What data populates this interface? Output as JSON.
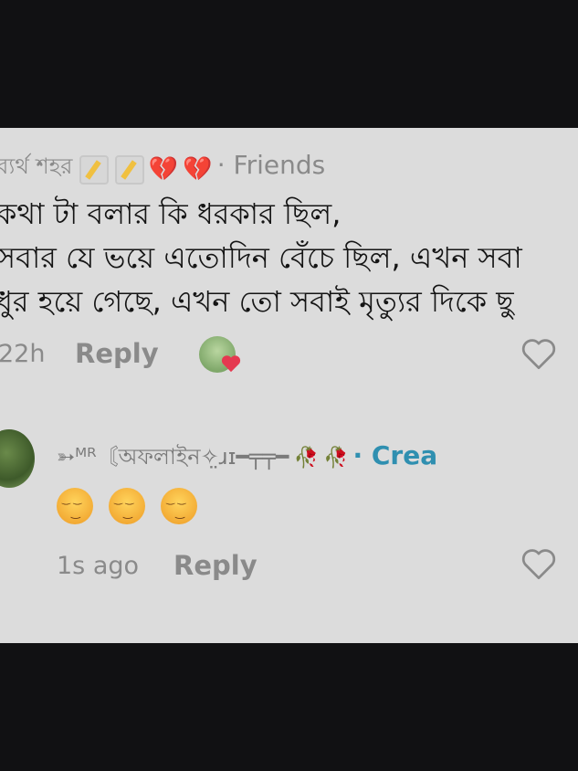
{
  "comment1": {
    "author": "ব্যর্থ শহর",
    "author_badge": "· Friends",
    "lines": [
      "কথা টা বলার কি ধরকার ছিল,",
      "সবার যে ভয়ে এতোদিন বেঁচে ছিল, এখন সবা",
      "ধুর হয়ে গেছে, এখন তো সবাই মৃত্যুর দিকে ছু"
    ],
    "time": "22h",
    "reply_label": "Reply"
  },
  "comment2": {
    "author": "➳ᴹᴿ〘অফলাইন✧̤ɹɪ━╤╤━",
    "author_badge": "· Crea",
    "emojis": "😌😌😌",
    "time": "1s ago",
    "reply_label": "Reply"
  }
}
